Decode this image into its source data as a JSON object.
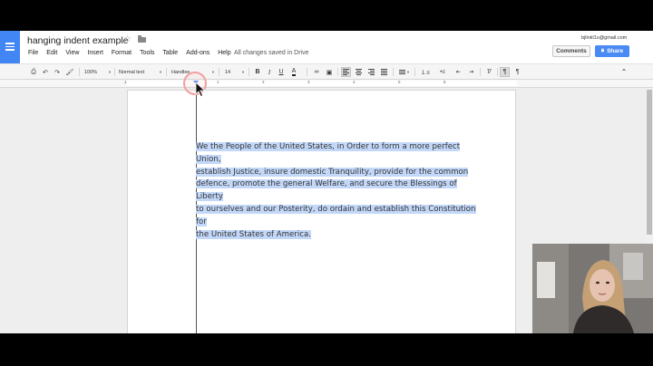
{
  "header": {
    "title": "hanging indent example",
    "menu": [
      "File",
      "Edit",
      "View",
      "Insert",
      "Format",
      "Tools",
      "Table",
      "Add-ons",
      "Help"
    ],
    "save_status": "All changes saved in Drive",
    "account": "bjlinkl1s@gmail.com",
    "comments_label": "Comments",
    "share_label": "Share"
  },
  "toolbar": {
    "zoom": "100%",
    "style": "Normal text",
    "font": "Handlee",
    "size": "14",
    "bold": "B",
    "italic": "I",
    "underline": "U",
    "text_color": "A"
  },
  "ruler": {
    "numbers": [
      "1",
      "1",
      "2",
      "3",
      "4",
      "5",
      "6"
    ]
  },
  "document": {
    "paragraph_lines": [
      "We the People of the United States, in Order to form a more perfect Union,",
      "establish Justice, insure domestic Tranquility, provide for the common",
      "defence, promote the general Welfare, and secure the Blessings of Liberty",
      "to ourselves and our Posterity, do ordain and establish this Constitution for",
      "the United States of America."
    ]
  },
  "colors": {
    "selection": "#c3d8f9",
    "brand": "#4285f4",
    "share": "#4a8af4"
  }
}
